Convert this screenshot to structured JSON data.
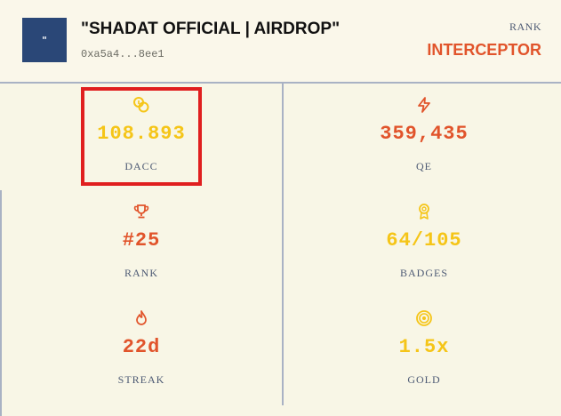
{
  "profile": {
    "avatar_glyph": "\"",
    "name": "\"SHADAT OFFICIAL | AIRDROP\"",
    "address": "0xa5a4...8ee1",
    "rank_label": "RANK",
    "rank_value": "INTERCEPTOR"
  },
  "stats": [
    {
      "icon": "coins-icon",
      "value": "108.893",
      "label": "DACC",
      "color": "#f5c518"
    },
    {
      "icon": "lightning-icon",
      "value": "359,435",
      "label": "QE",
      "color": "#e1542b"
    },
    {
      "icon": "trophy-icon",
      "value": "#25",
      "label": "RANK",
      "color": "#e1542b"
    },
    {
      "icon": "badge-icon",
      "value": "64/105",
      "label": "BADGES",
      "color": "#f5c518"
    },
    {
      "icon": "flame-icon",
      "value": "22d",
      "label": "STREAK",
      "color": "#e1542b"
    },
    {
      "icon": "target-icon",
      "value": "1.5x",
      "label": "GOLD",
      "color": "#f5c518"
    }
  ],
  "colors": {
    "accent_yellow": "#f5c518",
    "accent_orange": "#e1542b",
    "highlight_red": "#e01f1f",
    "avatar_bg": "#2a4777"
  }
}
